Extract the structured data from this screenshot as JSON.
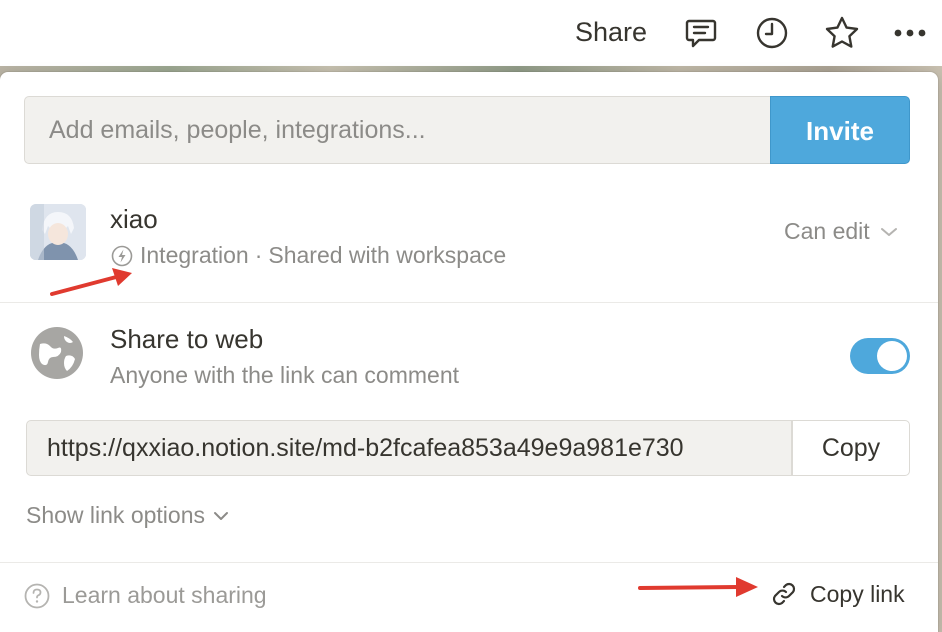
{
  "topbar": {
    "share_label": "Share",
    "icons": [
      "comment-icon",
      "history-clock-icon",
      "favorite-star-icon",
      "more-dots-icon"
    ]
  },
  "invite": {
    "placeholder": "Add emails, people, integrations...",
    "button_label": "Invite"
  },
  "member": {
    "name": "xiao",
    "type": "Integration",
    "separator": "·",
    "scope": "Shared with workspace",
    "permission": "Can edit"
  },
  "share_to_web": {
    "title": "Share to web",
    "subtitle": "Anyone with the link can comment",
    "enabled": true,
    "url": "https://qxxiao.notion.site/md-b2fcafea853a49e9a981e730",
    "copy_label": "Copy",
    "options_label": "Show link options"
  },
  "footer": {
    "learn_label": "Learn about sharing",
    "copy_link_label": "Copy link"
  },
  "colors": {
    "accent": "#4ea8dc",
    "annotation_arrow": "#e03a2f",
    "muted_text": "#8c8b88"
  }
}
